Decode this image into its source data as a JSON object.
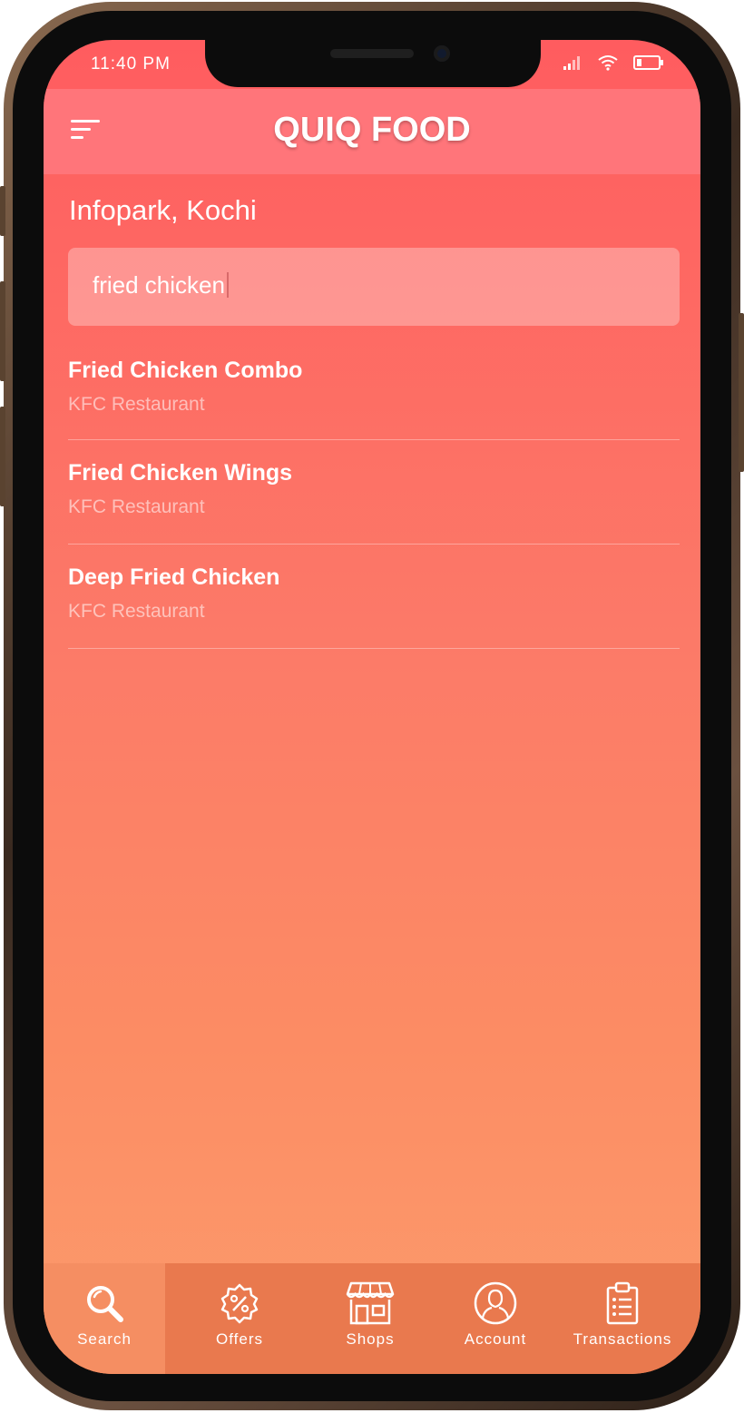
{
  "status_bar": {
    "time": "11:40 PM"
  },
  "header": {
    "app_title": "QUIQ FOOD"
  },
  "location": "Infopark, Kochi",
  "search": {
    "value": "fried chicken"
  },
  "results": [
    {
      "title": "Fried Chicken Combo",
      "restaurant": "KFC Restaurant"
    },
    {
      "title": "Fried Chicken Wings",
      "restaurant": "KFC Restaurant"
    },
    {
      "title": "Deep Fried Chicken",
      "restaurant": "KFC Restaurant"
    }
  ],
  "tabs": [
    {
      "label": "Search",
      "icon": "search-icon",
      "active": true
    },
    {
      "label": "Offers",
      "icon": "offer-badge-icon",
      "active": false
    },
    {
      "label": "Shops",
      "icon": "shop-icon",
      "active": false
    },
    {
      "label": "Account",
      "icon": "user-icon",
      "active": false
    },
    {
      "label": "Transactions",
      "icon": "clipboard-list-icon",
      "active": false
    }
  ],
  "colors": {
    "header": "#ff757a",
    "gradient_top": "#ff5c5f",
    "gradient_bottom": "#fb9b6c",
    "tabbar": "#e9794e",
    "tab_active": "#f58e62"
  }
}
